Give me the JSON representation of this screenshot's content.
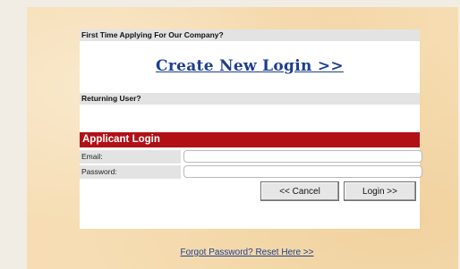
{
  "first_time": {
    "heading": "First Time Applying For Our Company?",
    "create_link": "Create New Login >>"
  },
  "returning": {
    "heading": "Returning User?"
  },
  "login": {
    "title": "Applicant Login",
    "email_label": "Email:",
    "email_value": "",
    "password_label": "Password:",
    "password_value": "",
    "cancel_label": "<< Cancel",
    "login_label": "Login >>"
  },
  "forgot_link": "Forgot Password? Reset Here >>",
  "colors": {
    "accent_red": "#b11016",
    "link_blue": "#1c3e8f",
    "parchment": "#f6ddb3"
  }
}
